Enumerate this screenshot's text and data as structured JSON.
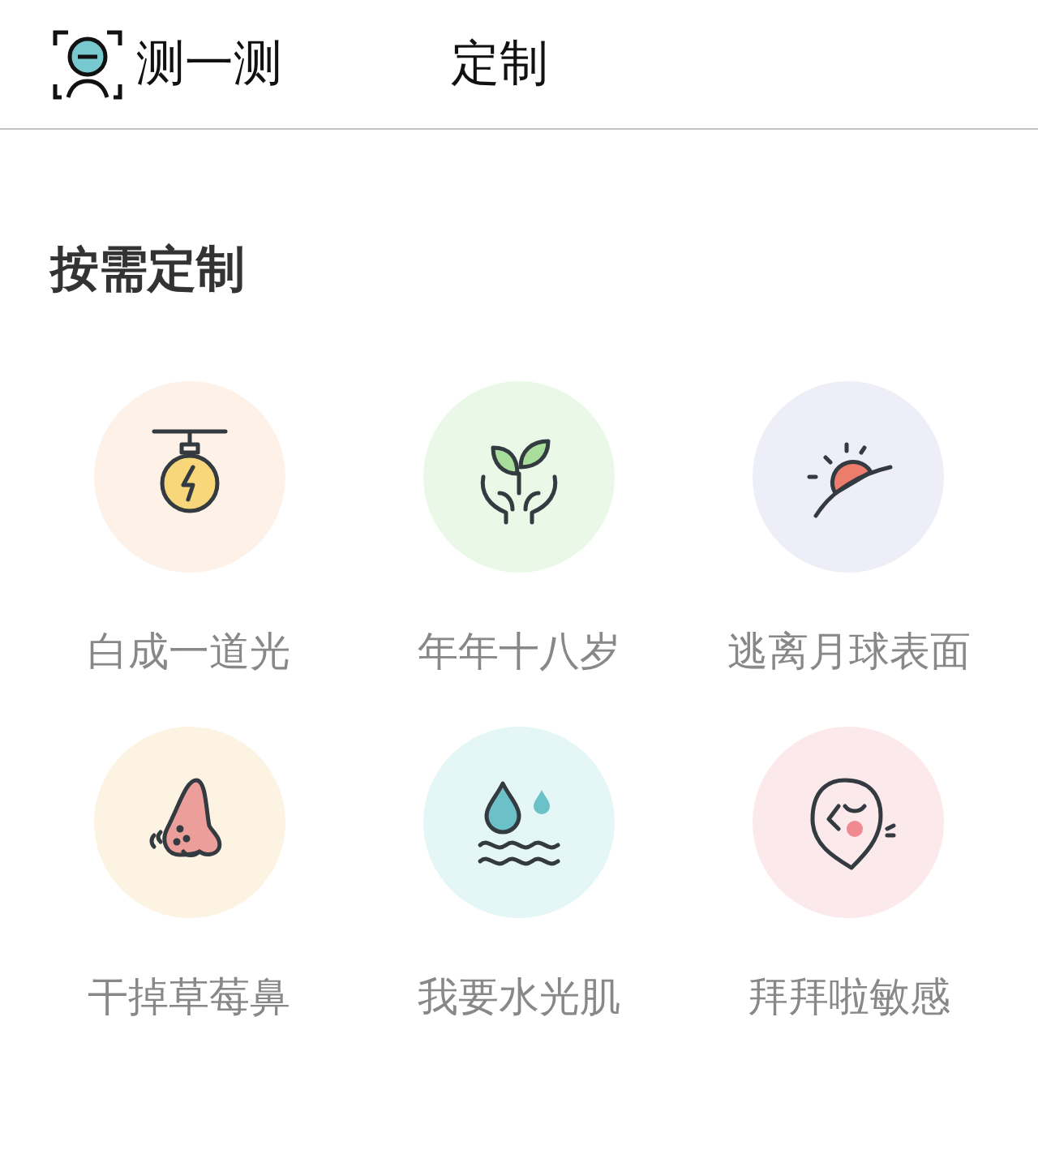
{
  "header": {
    "tabs": [
      {
        "label": "测一测",
        "kind": "scan"
      },
      {
        "label": "定制",
        "kind": "plain"
      }
    ]
  },
  "section": {
    "title": "按需定制"
  },
  "items": [
    {
      "label": "白成一道光",
      "kind": "bulb",
      "color": "#fdf1e8"
    },
    {
      "label": "年年十八岁",
      "kind": "sprout",
      "color": "#eaf8e8"
    },
    {
      "label": "逃离月球表面",
      "kind": "sunrise",
      "color": "#eeeef9"
    },
    {
      "label": "干掉草莓鼻",
      "kind": "nose",
      "color": "#fdf3e3"
    },
    {
      "label": "我要水光肌",
      "kind": "water",
      "color": "#e5f6f6"
    },
    {
      "label": "拜拜啦敏感",
      "kind": "face",
      "color": "#fbe9ec"
    }
  ]
}
